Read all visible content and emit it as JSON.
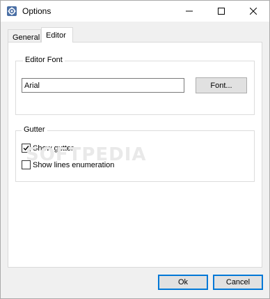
{
  "window": {
    "title": "Options"
  },
  "tabs": [
    {
      "label": "General",
      "active": false
    },
    {
      "label": "Editor",
      "active": true
    }
  ],
  "editor_font": {
    "group_label": "Editor Font",
    "font_value": "Arial",
    "font_button": "Font..."
  },
  "gutter": {
    "group_label": "Gutter",
    "show_gutter": {
      "label": "Show gutter",
      "checked": true
    },
    "show_lines": {
      "label": "Show lines enumeration",
      "checked": false
    }
  },
  "footer": {
    "ok_label": "Ok",
    "cancel_label": "Cancel"
  },
  "watermark": "SOFTPEDIA",
  "colors": {
    "accent": "#0078d7",
    "window_bg": "#f0f0f0",
    "page_bg": "#ffffff"
  }
}
